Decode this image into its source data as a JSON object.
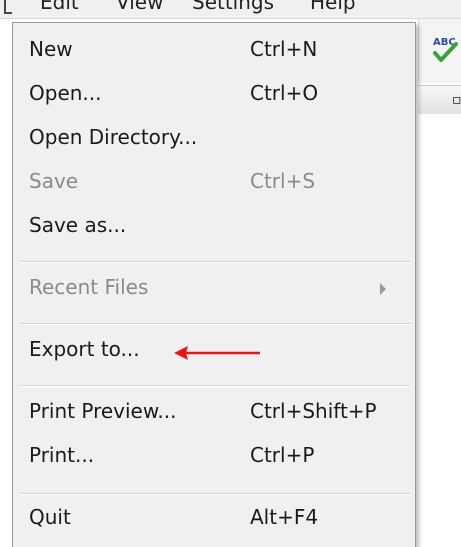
{
  "menubar": {
    "items": [
      {
        "label": "Edit"
      },
      {
        "label": "View"
      },
      {
        "label": "Settings"
      },
      {
        "label": "Help"
      }
    ]
  },
  "menu": {
    "new": {
      "label": "New",
      "shortcut": "Ctrl+N"
    },
    "open": {
      "label": "Open...",
      "shortcut": "Ctrl+O"
    },
    "open_directory": {
      "label": "Open Directory..."
    },
    "save": {
      "label": "Save",
      "shortcut": "Ctrl+S"
    },
    "save_as": {
      "label": "Save as..."
    },
    "recent_files": {
      "label": "Recent Files"
    },
    "export_to": {
      "label": "Export to..."
    },
    "print_preview": {
      "label": "Print Preview...",
      "shortcut": "Ctrl+Shift+P"
    },
    "print": {
      "label": "Print...",
      "shortcut": "Ctrl+P"
    },
    "quit": {
      "label": "Quit",
      "shortcut": "Alt+F4"
    }
  },
  "toolbar": {
    "spellcheck_icon_text": "ABC"
  },
  "colors": {
    "annotation_arrow": "#e8141c",
    "menu_bg": "#f0f0f0",
    "disabled_text": "#8a8a8a"
  }
}
